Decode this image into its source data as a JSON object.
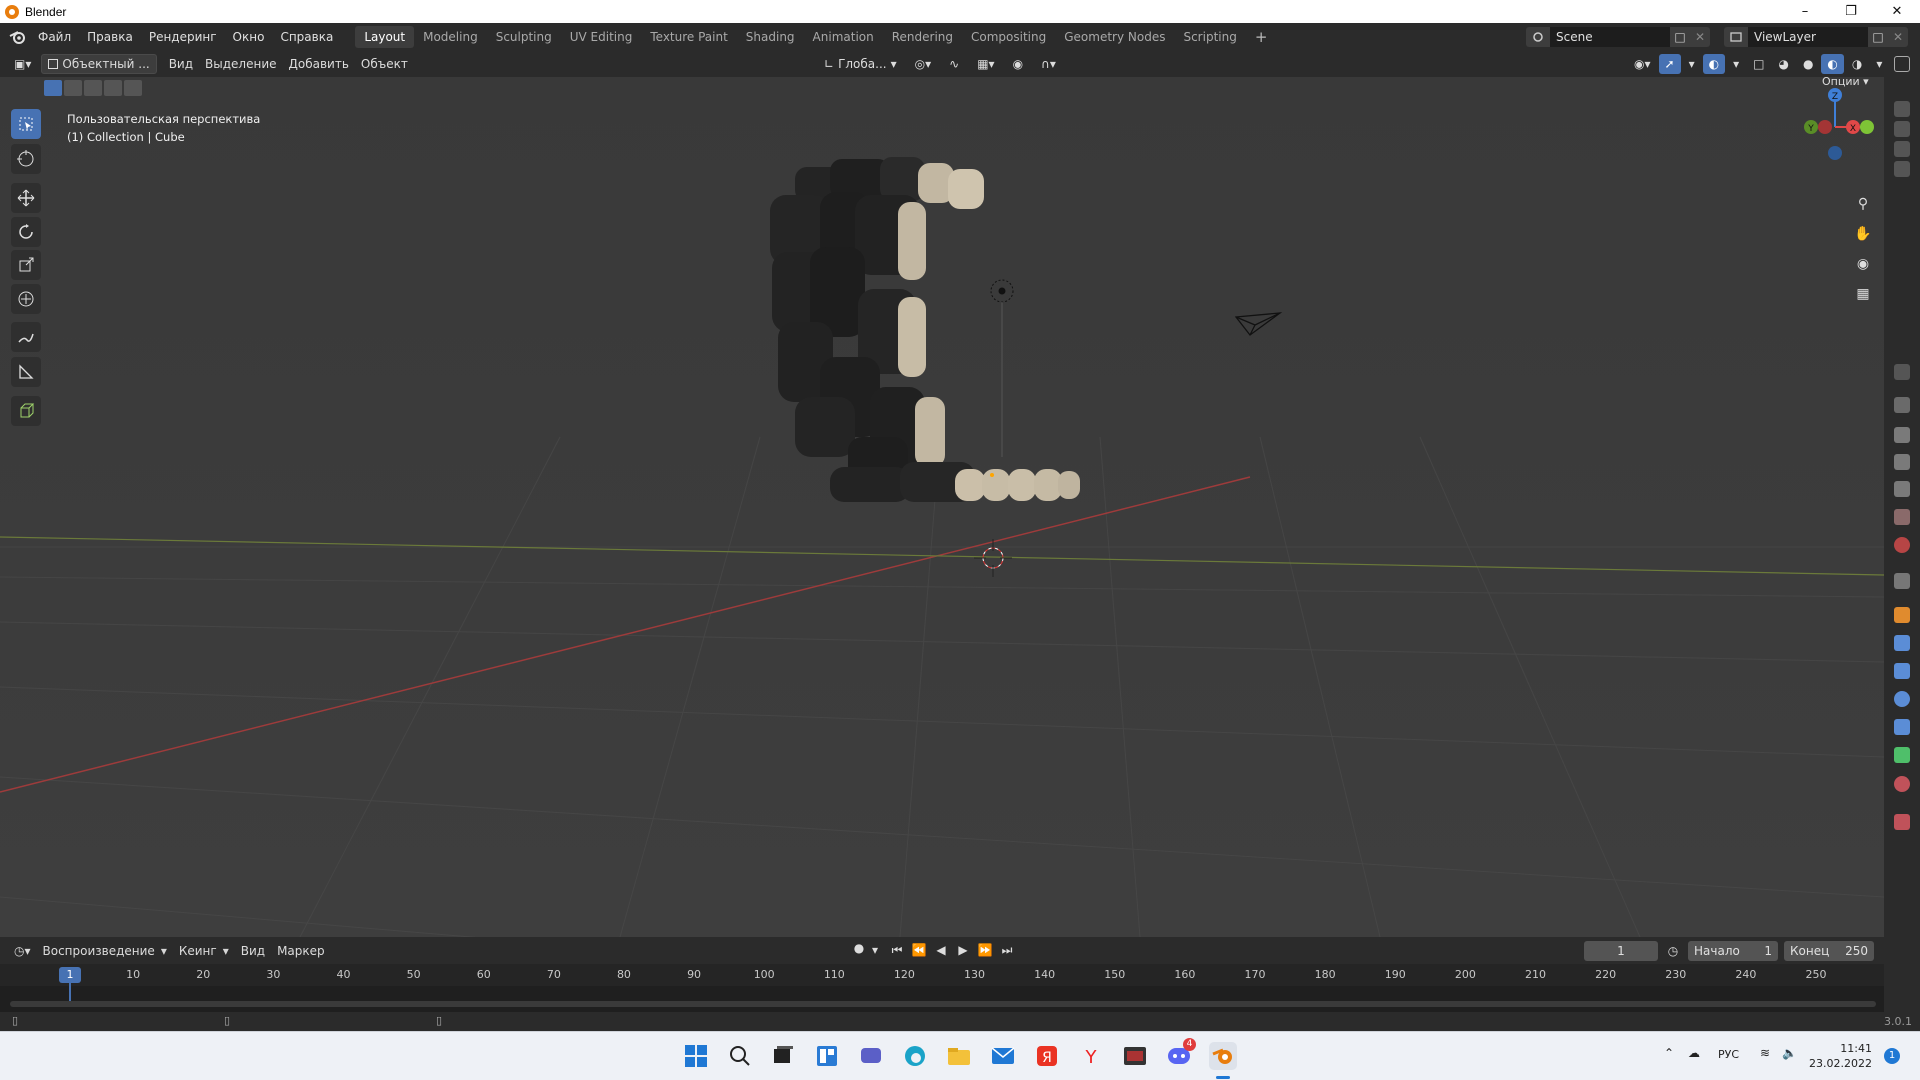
{
  "window": {
    "title": "Blender"
  },
  "menu": [
    "Файл",
    "Правка",
    "Рендеринг",
    "Окно",
    "Справка"
  ],
  "workspaces": [
    "Layout",
    "Modeling",
    "Sculpting",
    "UV Editing",
    "Texture Paint",
    "Shading",
    "Animation",
    "Rendering",
    "Compositing",
    "Geometry Nodes",
    "Scripting"
  ],
  "active_workspace": "Layout",
  "scene": {
    "name": "Scene",
    "view_layer": "ViewLayer"
  },
  "viewport_header": {
    "mode": "Объектный ...",
    "menus": [
      "Вид",
      "Выделение",
      "Добавить",
      "Объект"
    ],
    "transform_orientation": "Глоба...",
    "options": "Опции"
  },
  "viewport": {
    "perspective_label": "Пользовательская перспектива",
    "collection_label": "(1) Collection | Cube",
    "gizmo_axes": {
      "x": "X",
      "y": "Y",
      "z": "Z"
    }
  },
  "timeline": {
    "menus": [
      "Воспроизведение",
      "Кеинг",
      "Вид",
      "Маркер"
    ],
    "current_frame": "1",
    "start_label": "Начало",
    "start": "1",
    "end_label": "Конец",
    "end": "250",
    "ticks": [
      "1",
      "10",
      "20",
      "30",
      "40",
      "50",
      "60",
      "70",
      "80",
      "90",
      "100",
      "110",
      "120",
      "130",
      "140",
      "150",
      "160",
      "170",
      "180",
      "190",
      "200",
      "210",
      "220",
      "230",
      "240",
      "250"
    ]
  },
  "status": {
    "version": "3.0.1"
  },
  "taskbar": {
    "lang": "РУС",
    "time": "11:41",
    "date": "23.02.2022",
    "notification_count": "1",
    "discord_badge": "4"
  },
  "colors": {
    "accent": "#4772b3",
    "x_axis": "#e04848",
    "y_axis": "#7ec436",
    "z_axis": "#3f7fd8",
    "bg": "#3a3a3a"
  }
}
